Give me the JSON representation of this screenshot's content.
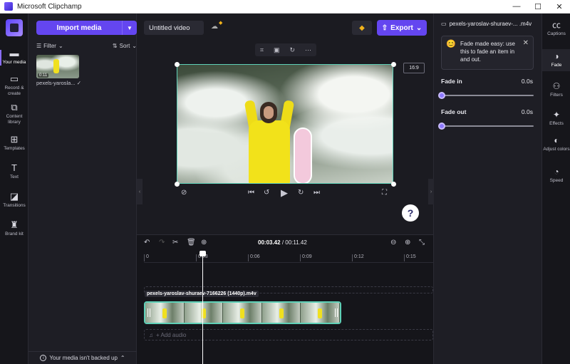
{
  "window": {
    "title": "Microsoft Clipchamp",
    "minimize": "—",
    "maximize": "☐",
    "close": "✕"
  },
  "leftnav": {
    "items": [
      {
        "label": "Your media",
        "icon": "media-icon"
      },
      {
        "label": "Record & create",
        "icon": "record-icon"
      },
      {
        "label": "Content library",
        "icon": "library-icon"
      },
      {
        "label": "Templates",
        "icon": "templates-icon"
      },
      {
        "label": "Text",
        "icon": "text-icon"
      },
      {
        "label": "Transitions",
        "icon": "transitions-icon"
      },
      {
        "label": "Brand kit",
        "icon": "brand-kit-icon"
      }
    ]
  },
  "media": {
    "import_label": "Import media",
    "filter_label": "Filter",
    "sort_label": "Sort",
    "thumb_duration": "0:11",
    "thumb_name": "pexels-yaroslа... ✓",
    "backup_text": "Your media isn't backed up"
  },
  "editor": {
    "project_title": "Untitled video",
    "export_label": "Export",
    "aspect_ratio": "16:9",
    "help_label": "?"
  },
  "timeline": {
    "current_time": "00:03.42",
    "separator": " / ",
    "total_time": "00:11.42",
    "ticks": [
      "0",
      "0:03",
      "0:06",
      "0:09",
      "0:12",
      "0:15"
    ],
    "clip_label": "pexels-yaroslav-shuraev-7166226 (1440p).m4v",
    "add_audio_label": "+ Add audio"
  },
  "properties": {
    "file_name": "pexels-yaroslav-shuraev-... .m4v",
    "tip_text": "Fade made easy: use this to fade an item in and out.",
    "fade_in_label": "Fade in",
    "fade_in_value": "0.0s",
    "fade_out_label": "Fade out",
    "fade_out_value": "0.0s"
  },
  "rail": {
    "items": [
      {
        "label": "Captions",
        "icon": "captions-icon"
      },
      {
        "label": "Fade",
        "icon": "fade-icon"
      },
      {
        "label": "Filters",
        "icon": "filters-icon"
      },
      {
        "label": "Effects",
        "icon": "effects-icon"
      },
      {
        "label": "Adjust colors",
        "icon": "adjust-colors-icon"
      },
      {
        "label": "Speed",
        "icon": "speed-icon"
      }
    ]
  },
  "colors": {
    "accent": "#6446f0",
    "selection": "#5fd1b8",
    "background": "#1b1b21"
  }
}
